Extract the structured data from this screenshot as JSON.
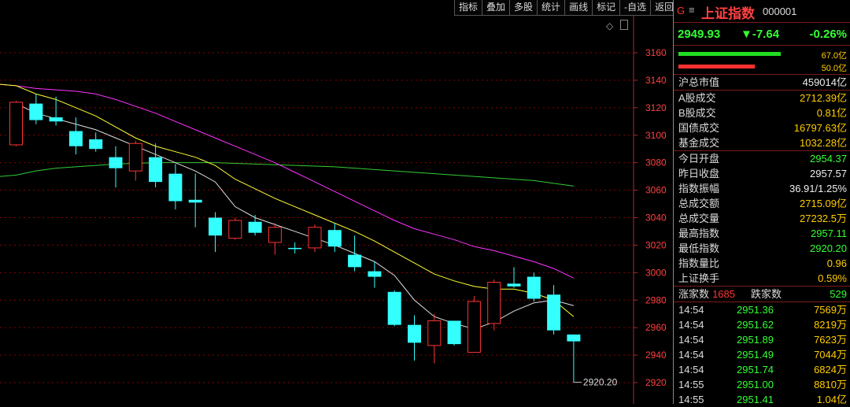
{
  "toolbar": {
    "buttons": [
      "指标",
      "叠加",
      "多股",
      "统计",
      "画线",
      "标记",
      "-自选",
      "返回"
    ]
  },
  "chart_data": {
    "type": "candlestick",
    "y_ticks": [
      3160,
      3140,
      3120,
      3100,
      3080,
      3060,
      3040,
      3020,
      3000,
      2980,
      2960,
      2940,
      2920
    ],
    "ylim": [
      2910,
      3180
    ],
    "candles": [
      {
        "o": 3093,
        "c": 3124,
        "h": 3125,
        "l": 3092
      },
      {
        "o": 3123,
        "c": 3111,
        "h": 3130,
        "l": 3108
      },
      {
        "o": 3113,
        "c": 3110,
        "h": 3128,
        "l": 3107
      },
      {
        "o": 3103,
        "c": 3092,
        "h": 3113,
        "l": 3086
      },
      {
        "o": 3097,
        "c": 3090,
        "h": 3102,
        "l": 3088
      },
      {
        "o": 3084,
        "c": 3076,
        "h": 3092,
        "l": 3062
      },
      {
        "o": 3074,
        "c": 3094,
        "h": 3096,
        "l": 3067
      },
      {
        "o": 3084,
        "c": 3066,
        "h": 3094,
        "l": 3062
      },
      {
        "o": 3072,
        "c": 3052,
        "h": 3079,
        "l": 3046
      },
      {
        "o": 3053,
        "c": 3051,
        "h": 3072,
        "l": 3033
      },
      {
        "o": 3040,
        "c": 3027,
        "h": 3044,
        "l": 3015
      },
      {
        "o": 3025,
        "c": 3038,
        "h": 3040,
        "l": 3024
      },
      {
        "o": 3037,
        "c": 3029,
        "h": 3042,
        "l": 3027
      },
      {
        "o": 3022,
        "c": 3033,
        "h": 3036,
        "l": 3013
      },
      {
        "o": 3018,
        "c": 3018,
        "h": 3022,
        "l": 3014
      },
      {
        "o": 3018,
        "c": 3033,
        "h": 3035,
        "l": 3015
      },
      {
        "o": 3031,
        "c": 3019,
        "h": 3036,
        "l": 3015
      },
      {
        "o": 3013,
        "c": 3004,
        "h": 3027,
        "l": 3001
      },
      {
        "o": 3001,
        "c": 2997,
        "h": 3008,
        "l": 2989
      },
      {
        "o": 2986,
        "c": 2962,
        "h": 2987,
        "l": 2961
      },
      {
        "o": 2962,
        "c": 2949,
        "h": 2969,
        "l": 2936
      },
      {
        "o": 2947,
        "c": 2965,
        "h": 2970,
        "l": 2934
      },
      {
        "o": 2965,
        "c": 2948,
        "h": 2965,
        "l": 2947
      },
      {
        "o": 2942,
        "c": 2979,
        "h": 2983,
        "l": 2942
      },
      {
        "o": 2963,
        "c": 2993,
        "h": 2995,
        "l": 2958
      },
      {
        "o": 2992,
        "c": 2990,
        "h": 3004,
        "l": 2989
      },
      {
        "o": 2997,
        "c": 2981,
        "h": 3000,
        "l": 2979
      },
      {
        "o": 2984,
        "c": 2958,
        "h": 2991,
        "l": 2955
      },
      {
        "o": 2955,
        "c": 2950,
        "h": 2954,
        "l": 2920
      }
    ],
    "ma_white": [
      3123,
      3116,
      3112,
      3108,
      3104,
      3098,
      3092,
      3086,
      3080,
      3074,
      3066,
      3048,
      3040,
      3035,
      3030,
      3025,
      3020,
      3014,
      3008,
      2998,
      2980,
      2968,
      2963,
      2959,
      2964,
      2972,
      2978,
      2980,
      2976
    ],
    "ma_yellow": [
      3136,
      3130,
      3126,
      3120,
      3114,
      3106,
      3098,
      3092,
      3088,
      3084,
      3078,
      3068,
      3061,
      3054,
      3048,
      3042,
      3036,
      3030,
      3023,
      3015,
      3007,
      2999,
      2994,
      2990,
      2988,
      2988,
      2985,
      2980,
      2968
    ],
    "ma_magenta": [
      3136,
      3134,
      3133,
      3132,
      3130,
      3126,
      3121,
      3116,
      3110,
      3104,
      3098,
      3092,
      3086,
      3080,
      3073,
      3066,
      3059,
      3052,
      3045,
      3038,
      3032,
      3028,
      3024,
      3019,
      3016,
      3012,
      3008,
      3003,
      2996
    ],
    "ma_green": [
      3071,
      3074,
      3076,
      3077,
      3078,
      3079,
      3079.5,
      3080,
      3080,
      3080,
      3080,
      3079.5,
      3079,
      3078.5,
      3078,
      3077.5,
      3077,
      3076,
      3075,
      3074,
      3073,
      3072,
      3071,
      3070,
      3069,
      3068,
      3067,
      3065,
      3063
    ],
    "low_annotation": "2920.20",
    "low_value": 2920.2
  },
  "panel": {
    "g_label": "G",
    "menu_icon": "≡",
    "index_name": "上证指数",
    "index_code": "000001",
    "price": "2949.93",
    "change": "▼-7.64",
    "change_pct": "-0.26%",
    "bar_green_label": "67.0亿",
    "bar_red_label": "50.0亿",
    "bar_green_fraction": 0.93,
    "bar_red_fraction": 0.69,
    "market_cap": {
      "k": "沪总市值",
      "v": "459014亿"
    },
    "volumes": [
      {
        "k": "A股成交",
        "v": "2712.39亿"
      },
      {
        "k": "B股成交",
        "v": "0.81亿"
      },
      {
        "k": "国债成交",
        "v": "16797.63亿"
      },
      {
        "k": "基金成交",
        "v": "1032.28亿"
      }
    ],
    "stats": [
      {
        "k": "今日开盘",
        "v": "2954.37",
        "c": "green"
      },
      {
        "k": "昨日收盘",
        "v": "2957.57",
        "c": "white"
      },
      {
        "k": "指数振幅",
        "v": "36.91/1.25%",
        "c": "white"
      },
      {
        "k": "总成交额",
        "v": "2715.09亿",
        "c": "yellow"
      },
      {
        "k": "总成交量",
        "v": "27232.5万",
        "c": "yellow"
      },
      {
        "k": "最高指数",
        "v": "2957.11",
        "c": "green"
      },
      {
        "k": "最低指数",
        "v": "2920.20",
        "c": "green"
      },
      {
        "k": "指数量比",
        "v": "0.96",
        "c": "yellow"
      },
      {
        "k": "上证换手",
        "v": "0.59%",
        "c": "yellow"
      }
    ],
    "breadth": {
      "up_label": "涨家数",
      "up": "1685",
      "down_label": "跌家数",
      "down": "529"
    },
    "ticks": [
      {
        "t": "14:54",
        "p": "2951.36",
        "v": "7569万"
      },
      {
        "t": "14:54",
        "p": "2951.62",
        "v": "8219万"
      },
      {
        "t": "14:54",
        "p": "2951.89",
        "v": "7623万"
      },
      {
        "t": "14:54",
        "p": "2951.49",
        "v": "7044万"
      },
      {
        "t": "14:54",
        "p": "2951.74",
        "v": "6824万"
      },
      {
        "t": "14:55",
        "p": "2951.00",
        "v": "8810万"
      },
      {
        "t": "14:55",
        "p": "2951.41",
        "v": "1.04亿"
      }
    ]
  },
  "colors": {
    "up": "#ff3333",
    "down": "#33ffff",
    "ma1": "#e0e0e0",
    "ma2": "#ffff33",
    "ma3": "#ff33ff",
    "ma4": "#33cc33",
    "grid": "#8b0000",
    "axis": "#aa2a2a"
  }
}
